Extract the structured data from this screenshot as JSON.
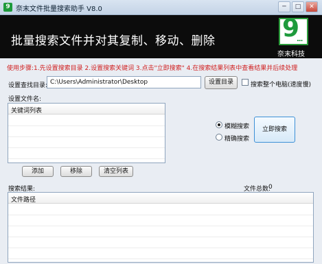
{
  "window": {
    "icon_glyph": "9",
    "title": "奈末文件批量搜索助手 V8.0",
    "controls": {
      "minimize": "─",
      "maximize": "□",
      "close": "✕"
    }
  },
  "banner": {
    "title": "批量搜索文件并对其复制、移动、删除",
    "logo_text": "9",
    "logo_dots": "...",
    "logo_caption": "奈末科技",
    "logo_color": "#1e9a3c"
  },
  "instructions": "使用步骤:1.先设置搜索目录 2.设置搜索关键词 3.点击\"立即搜索\" 4.在搜索结果列表中查看结果并后续处理",
  "directory": {
    "label": "设置查找目录:",
    "value": "C:\\Users\\Administrator\\Desktop",
    "button": "设置目录",
    "search_all_label": "搜索整个电脑(速度慢)",
    "search_all_checked": false
  },
  "filename": {
    "label": "设置文件名:",
    "column": "关键词列表",
    "buttons": {
      "add": "添加",
      "remove": "移除",
      "clear": "清空列表"
    }
  },
  "mode": {
    "fuzzy_label": "模糊搜索",
    "exact_label": "精确搜索",
    "selected": "fuzzy",
    "search_button": "立即搜索"
  },
  "results": {
    "label": "搜索结果:",
    "count_label": "文件总数:",
    "count": "0",
    "column": "文件路径"
  }
}
